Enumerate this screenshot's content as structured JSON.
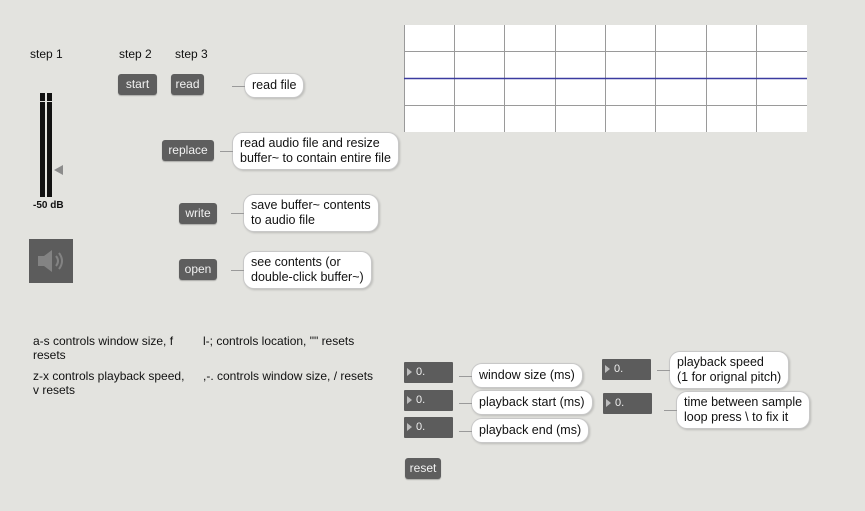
{
  "steps": {
    "step1": "step 1",
    "step2": "step 2",
    "step3": "step 3"
  },
  "buttons": {
    "start": "start",
    "read": "read",
    "replace": "replace",
    "write": "write",
    "open": "open",
    "reset": "reset"
  },
  "comments": {
    "read": [
      "read file"
    ],
    "replace": [
      "read audio file and resize",
      "buffer~ to contain entire file"
    ],
    "write": [
      "save buffer~ contents",
      "to audio file"
    ],
    "open": [
      "see contents (or",
      "double-click buffer~)"
    ],
    "window_size": [
      "window size (ms)"
    ],
    "playback_start": [
      "playback start (ms)"
    ],
    "playback_end": [
      "playback end (ms)"
    ],
    "playback_speed": [
      "playback speed",
      "(1 for orignal pitch)"
    ],
    "time_between": [
      "time between sample",
      "loop press \\  to fix it"
    ]
  },
  "meter": {
    "label": "-50 dB",
    "level_fraction": 0.0
  },
  "speaker": {
    "icon": "speaker-icon",
    "state": "off"
  },
  "instructions": {
    "as": "a-s controls window size, f resets",
    "zx": "z-x controls playback speed, v resets",
    "lsemi": "l-; controls location, \"\" resets",
    "comma": ",-. controls window size, / resets"
  },
  "number_boxes": {
    "window_size": "0.",
    "playback_start": "0.",
    "playback_end": "0.",
    "playback_speed": "0.",
    "time_between": "0."
  },
  "waveform": {
    "grid_columns": 8,
    "grid_rows": 4,
    "line_color": "#3b3ba0"
  }
}
